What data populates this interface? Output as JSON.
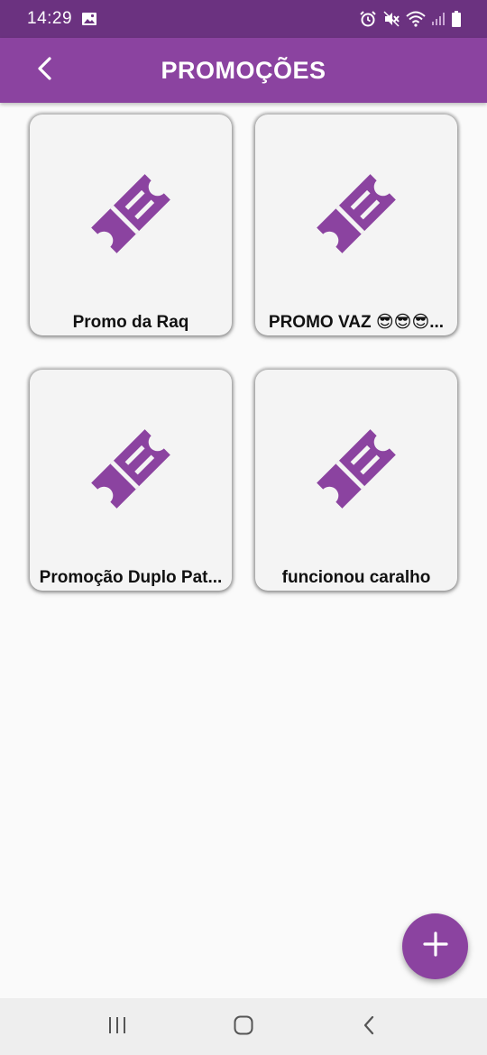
{
  "status_bar": {
    "time": "14:29",
    "icons": [
      "gallery-icon",
      "alarm-icon",
      "mute-icon",
      "wifi-icon",
      "signal-icon",
      "battery-icon"
    ]
  },
  "app_bar": {
    "title": "PROMOÇÕES",
    "back_icon": "chevron-left-icon"
  },
  "promotions": [
    {
      "label": "Promo da Raq",
      "icon": "ticket-icon"
    },
    {
      "label": "PROMO VAZ 😎😎😎...",
      "icon": "ticket-icon"
    },
    {
      "label": "Promoção Duplo Pat...",
      "icon": "ticket-icon"
    },
    {
      "label": "funcionou caralho",
      "icon": "ticket-icon"
    }
  ],
  "fab": {
    "icon": "plus-icon"
  },
  "nav_bar": {
    "buttons": [
      "recents-icon",
      "home-icon",
      "back-icon"
    ]
  },
  "colors": {
    "status_bar": "#6b3280",
    "primary": "#8b43a0",
    "card_bg": "#f4f4f4",
    "page_bg": "#fafafa"
  }
}
